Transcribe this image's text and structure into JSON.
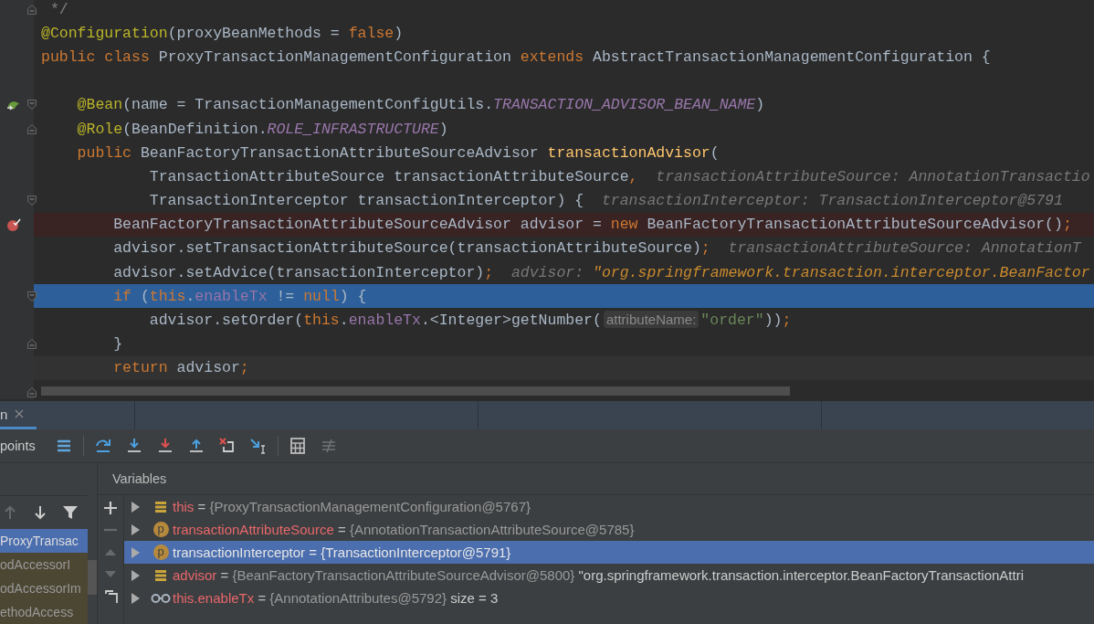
{
  "editor": {
    "lines": [
      {
        "kind": "code",
        "fold_start": false,
        "fold_end": true,
        "tokens": [
          {
            "kind": "comment",
            "t": " */"
          }
        ]
      },
      {
        "kind": "code",
        "fold_start": false,
        "fold_end": false,
        "tokens": [
          {
            "kind": "ann",
            "t": "@Configuration"
          },
          {
            "kind": "plain",
            "t": "(proxyBeanMethods = "
          },
          {
            "kind": "kw",
            "t": "false"
          },
          {
            "kind": "plain",
            "t": ")"
          }
        ]
      },
      {
        "kind": "code",
        "fold_start": false,
        "fold_end": false,
        "tokens": [
          {
            "kind": "kw",
            "t": "public class "
          },
          {
            "kind": "plain",
            "t": "ProxyTransactionManagementConfiguration "
          },
          {
            "kind": "kw",
            "t": "extends "
          },
          {
            "kind": "plain",
            "t": "AbstractTransactionManagementConfiguration {"
          }
        ]
      },
      {
        "kind": "code",
        "fold_start": false,
        "fold_end": false
      },
      {
        "kind": "bean",
        "fold_start": true,
        "fold_end": false,
        "tokens": [
          {
            "kind": "ann",
            "t": "    @Bean"
          },
          {
            "kind": "plain",
            "t": "(name = TransactionManagementConfigUtils."
          },
          {
            "kind": "const",
            "t": "TRANSACTION_ADVISOR_BEAN_NAME"
          },
          {
            "kind": "plain",
            "t": ")"
          }
        ]
      },
      {
        "kind": "code",
        "fold_start": false,
        "fold_end": true,
        "tokens": [
          {
            "kind": "ann",
            "t": "    @Role"
          },
          {
            "kind": "plain",
            "t": "(BeanDefinition."
          },
          {
            "kind": "const",
            "t": "ROLE_INFRASTRUCTURE"
          },
          {
            "kind": "plain",
            "t": ")"
          }
        ]
      },
      {
        "kind": "code",
        "fold_start": false,
        "fold_end": false,
        "tokens": [
          {
            "kind": "kw",
            "t": "    public "
          },
          {
            "kind": "plain",
            "t": "BeanFactoryTransactionAttributeSourceAdvisor "
          },
          {
            "kind": "method",
            "t": "transactionAdvisor"
          },
          {
            "kind": "plain",
            "t": "("
          }
        ]
      },
      {
        "kind": "code",
        "fold_start": false,
        "fold_end": false,
        "tokens": [
          {
            "kind": "plain",
            "t": "            TransactionAttributeSource transactionAttributeSource"
          },
          {
            "kind": "kw",
            "t": ","
          },
          {
            "kind": "hint",
            "t": "transactionAttributeSource: AnnotationTransactio"
          }
        ]
      },
      {
        "kind": "code",
        "fold_start": true,
        "fold_end": false,
        "tokens": [
          {
            "kind": "plain",
            "t": "            TransactionInterceptor transactionInterceptor) {"
          },
          {
            "kind": "hint",
            "t": "transactionInterceptor: TransactionInterceptor@5791"
          }
        ]
      },
      {
        "kind": "breakpoint",
        "fold_start": false,
        "fold_end": false,
        "tokens": [
          {
            "kind": "plain",
            "t": "        BeanFactoryTransactionAttributeSourceAdvisor advisor = "
          },
          {
            "kind": "kw",
            "t": "new "
          },
          {
            "kind": "plain",
            "t": "BeanFactoryTransactionAttributeSourceAdvisor()"
          },
          {
            "kind": "kw",
            "t": ";"
          }
        ]
      },
      {
        "kind": "code",
        "fold_start": false,
        "fold_end": false,
        "tokens": [
          {
            "kind": "plain",
            "t": "        advisor.setTransactionAttributeSource(transactionAttributeSource)"
          },
          {
            "kind": "kw",
            "t": ";"
          },
          {
            "kind": "hint",
            "t": "transactionAttributeSource: AnnotationT"
          }
        ]
      },
      {
        "kind": "code",
        "fold_start": false,
        "fold_end": false,
        "tokens": [
          {
            "kind": "plain",
            "t": "        advisor.setAdvice(transactionInterceptor)"
          },
          {
            "kind": "kw",
            "t": ";"
          },
          {
            "kind": "hint",
            "t": "advisor: "
          },
          {
            "kind": "hintstr",
            "t": "\"org.springframework.transaction.interceptor.BeanFactor"
          }
        ]
      },
      {
        "kind": "current",
        "fold_start": true,
        "fold_end": false,
        "tokens": [
          {
            "kind": "kw",
            "t": "        if "
          },
          {
            "kind": "plain",
            "t": "("
          },
          {
            "kind": "kw",
            "t": "this"
          },
          {
            "kind": "plain",
            "t": "."
          },
          {
            "kind": "field",
            "t": "enableTx"
          },
          {
            "kind": "plain",
            "t": " != "
          },
          {
            "kind": "kw",
            "t": "null"
          },
          {
            "kind": "plain",
            "t": ") {"
          }
        ]
      },
      {
        "kind": "code",
        "fold_start": false,
        "fold_end": false,
        "tokens": [
          {
            "kind": "plain",
            "t": "            advisor.setOrder("
          },
          {
            "kind": "kw",
            "t": "this"
          },
          {
            "kind": "plain",
            "t": "."
          },
          {
            "kind": "field",
            "t": "enableTx"
          },
          {
            "kind": "plain",
            "t": ".<Integer>getNumber("
          },
          {
            "kind": "param",
            "t": "attributeName:"
          },
          {
            "kind": "str",
            "t": "\"order\""
          },
          {
            "kind": "plain",
            "t": "))"
          },
          {
            "kind": "kw",
            "t": ";"
          }
        ]
      },
      {
        "kind": "code",
        "fold_start": false,
        "fold_end": true,
        "tokens": [
          {
            "kind": "plain",
            "t": "        }"
          }
        ]
      },
      {
        "kind": "caret",
        "fold_start": false,
        "fold_end": false,
        "tokens": [
          {
            "kind": "kw",
            "t": "        return "
          },
          {
            "kind": "plain",
            "t": "advisor"
          },
          {
            "kind": "kw",
            "t": ";"
          }
        ]
      },
      {
        "kind": "code",
        "fold_start": false,
        "fold_end": true
      }
    ]
  },
  "debug_tabs": [
    {
      "label": "n",
      "selected": true
    }
  ],
  "toolbar": {
    "label": "points",
    "buttons": [
      {
        "kind": "list",
        "disabled": false
      },
      {
        "kind": "step-over",
        "disabled": false
      },
      {
        "kind": "step-into",
        "disabled": false
      },
      {
        "kind": "force-step-into",
        "disabled": false
      },
      {
        "kind": "step-out",
        "disabled": false
      },
      {
        "kind": "drop-frame",
        "disabled": false
      },
      {
        "kind": "run-to-cursor",
        "disabled": false
      },
      {
        "kind": "evaluate",
        "disabled": false
      },
      {
        "kind": "trace",
        "disabled": true
      }
    ]
  },
  "frames": {
    "buttons": [
      {
        "kind": "up",
        "disabled": true
      },
      {
        "kind": "down",
        "disabled": false
      },
      {
        "kind": "filter",
        "disabled": false
      }
    ],
    "items": [
      {
        "label": "ProxyTransac",
        "selected": true
      },
      {
        "label": "odAccessorI",
        "selected": false
      },
      {
        "label": "odAccessorIm",
        "selected": false
      },
      {
        "label": "ethodAccess",
        "selected": false
      }
    ]
  },
  "variables": {
    "title": "Variables",
    "side_buttons": [
      {
        "kind": "add",
        "disabled": false
      },
      {
        "kind": "remove",
        "disabled": true
      },
      {
        "kind": "up",
        "disabled": true
      },
      {
        "kind": "down",
        "disabled": true
      },
      {
        "kind": "copy",
        "disabled": false
      }
    ],
    "rows": [
      {
        "kind": "field",
        "name": "this",
        "operator": "=",
        "value": "{ProxyTransactionManagementConfiguration@5767}",
        "selected": false
      },
      {
        "kind": "param",
        "badge": "p",
        "name": "transactionAttributeSource",
        "operator": "=",
        "value": "{AnnotationTransactionAttributeSource@5785}",
        "selected": false
      },
      {
        "kind": "param",
        "badge": "p",
        "name": "transactionInterceptor",
        "operator": "=",
        "value": "{TransactionInterceptor@5791}",
        "selected": true
      },
      {
        "kind": "field",
        "name": "advisor",
        "operator": "=",
        "value": "{BeanFactoryTransactionAttributeSourceAdvisor@5800}",
        "extra": "\"org.springframework.transaction.interceptor.BeanFactoryTransactionAttri",
        "selected": false
      },
      {
        "kind": "watch",
        "name": "this.enableTx",
        "operator": "=",
        "value": "{AnnotationAttributes@5792}",
        "extra": "size = 3",
        "selected": false
      }
    ]
  }
}
